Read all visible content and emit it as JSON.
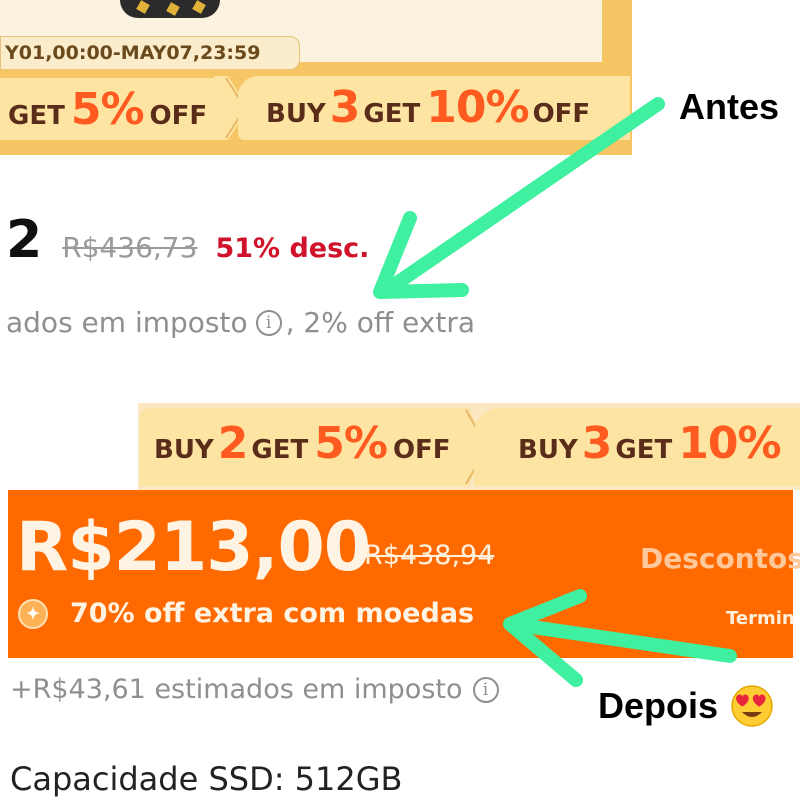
{
  "before": {
    "label": "Antes",
    "promo_period": "Y01,00:00-MAY07,23:59",
    "coupons": [
      {
        "prefix": "GET",
        "value": "5%",
        "suffix": "OFF"
      },
      {
        "prefix": "BUY",
        "qty": "3",
        "mid": "GET",
        "value": "10%",
        "suffix": "OFF"
      }
    ],
    "price_fragment": "2",
    "original_price": "R$436,73",
    "discount": "51% desc.",
    "tax_text_a": "ados em imposto",
    "tax_text_b": ", 2% off extra",
    "info_glyph": "i"
  },
  "after": {
    "label": "Depois",
    "emoji": "heart-eyes-emoji",
    "coupons": [
      {
        "prefix": "BUY",
        "qty": "2",
        "mid": "GET",
        "value": "5%",
        "suffix": "OFF"
      },
      {
        "prefix": "BUY",
        "qty": "3",
        "mid": "GET",
        "value": "10%"
      }
    ],
    "price": "R$213,00",
    "original_price": "R$438,94",
    "descontos": "Descontos",
    "coins_text": "70% off extra com moedas",
    "termina": "Termin",
    "tax_text": "+R$43,61 estimados em imposto",
    "info_glyph": "i",
    "capacity": "Capacidade SSD: 512GB"
  },
  "colors": {
    "annotation_arrow": "#3ff0a0",
    "orange_band": "#ff6a00",
    "discount_red": "#d0132b",
    "coupon_orange": "#ff5a1f"
  }
}
